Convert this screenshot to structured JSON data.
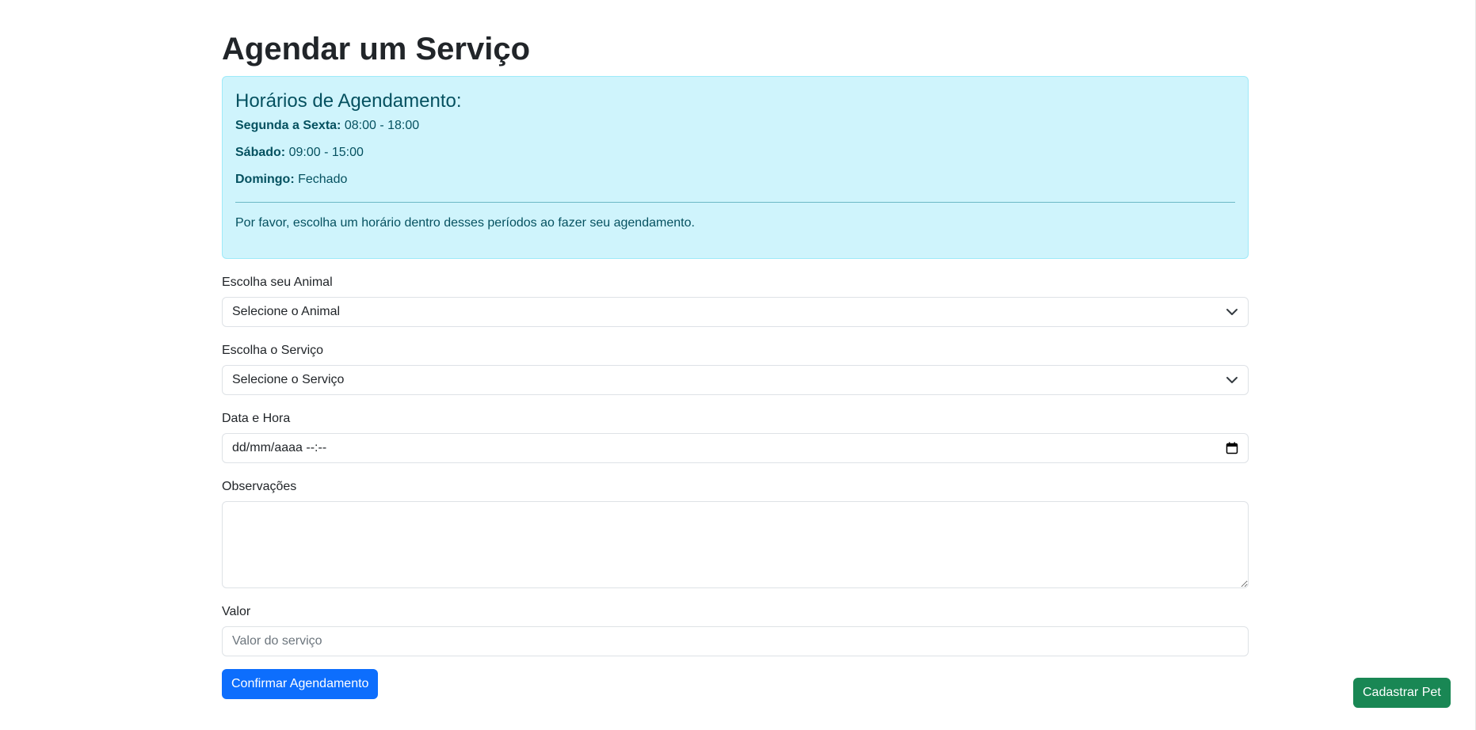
{
  "page": {
    "title": "Agendar um Serviço"
  },
  "schedule": {
    "heading": "Horários de Agendamento:",
    "rows": [
      {
        "day": "Segunda a Sexta:",
        "hours": "08:00 - 18:00"
      },
      {
        "day": "Sábado:",
        "hours": "09:00 - 15:00"
      },
      {
        "day": "Domingo:",
        "hours": "Fechado"
      }
    ],
    "note": "Por favor, escolha um horário dentro desses períodos ao fazer seu agendamento."
  },
  "form": {
    "animal_label": "Escolha seu Animal",
    "animal_value": "Selecione o Animal",
    "service_label": "Escolha o Serviço",
    "service_value": "Selecione o Serviço",
    "datetime_label": "Data e Hora",
    "datetime_value": "dd/mm/aaaa --:--",
    "notes_label": "Observações",
    "notes_value": "",
    "price_label": "Valor",
    "price_placeholder": "Valor do serviço",
    "submit_label": "Confirmar Agendamento"
  },
  "floating": {
    "register_pet_label": "Cadastrar Pet"
  },
  "colors": {
    "primary": "#0d6efd",
    "success": "#198754",
    "info_bg": "#cff4fc",
    "info_text": "#055160"
  }
}
